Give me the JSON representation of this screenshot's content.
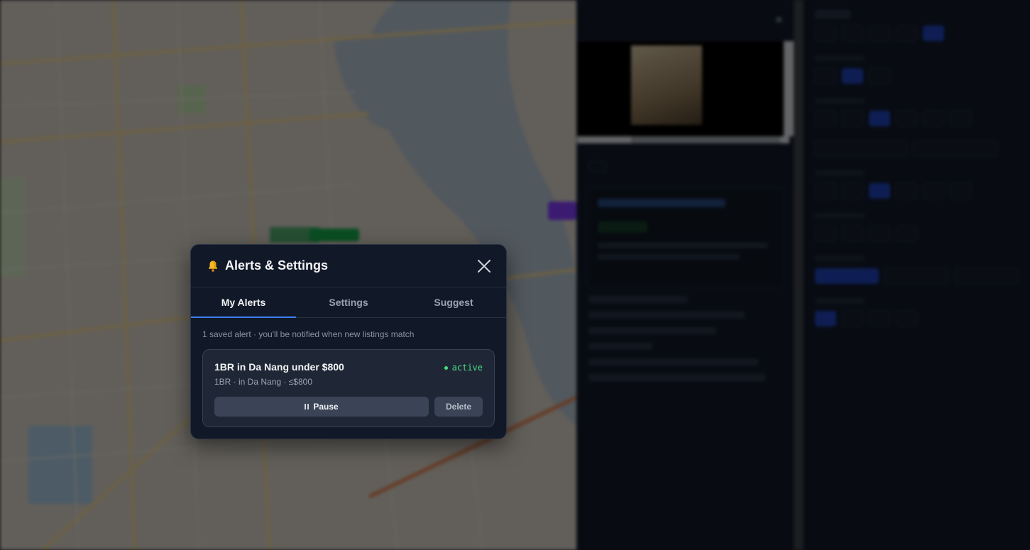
{
  "modal": {
    "title": "Alerts & Settings",
    "icon": "bell-icon",
    "tabs": [
      {
        "label": "My Alerts",
        "active": true
      },
      {
        "label": "Settings",
        "active": false
      },
      {
        "label": "Suggest",
        "active": false
      }
    ],
    "summary": "1 saved alert · you'll be notified when new listings match",
    "alerts": [
      {
        "name": "1BR in Da Nang under $800",
        "status": "active",
        "meta": "1BR · in Da Nang · ≤$800",
        "pause_label": "Pause",
        "delete_label": "Delete"
      }
    ]
  },
  "colors": {
    "accent": "#3b82f6",
    "status_active": "#4ade80",
    "modal_bg": "#111827",
    "card_bg": "#1f2736"
  }
}
